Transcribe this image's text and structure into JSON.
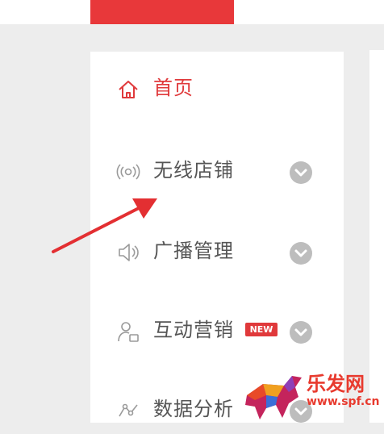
{
  "header": {
    "active_tab_color": "#e8383a"
  },
  "sidebar": {
    "items": [
      {
        "label": "首页",
        "icon": "home-icon",
        "active": true
      },
      {
        "label": "无线店铺",
        "icon": "wireless-icon",
        "expandable": true
      },
      {
        "label": "广播管理",
        "icon": "speaker-icon",
        "expandable": true
      },
      {
        "label": "互动营销",
        "icon": "user-interact-icon",
        "expandable": true,
        "badge": "NEW"
      },
      {
        "label": "数据分析",
        "icon": "chart-icon",
        "expandable": true
      }
    ]
  },
  "colors": {
    "accent": "#e0393b",
    "text": "#555555",
    "chevron": "#bdbdbd"
  },
  "watermark": {
    "title": "乐发网",
    "url": "www.spf.cn"
  }
}
